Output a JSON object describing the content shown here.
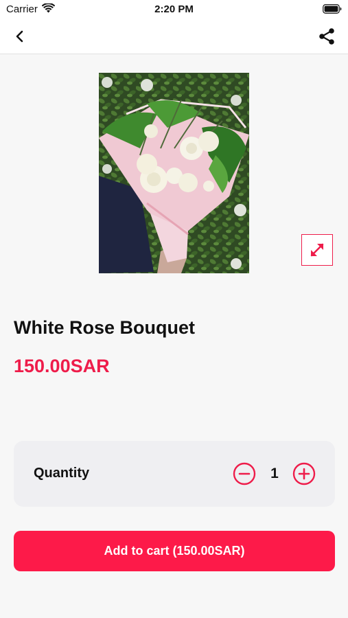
{
  "status_bar": {
    "carrier": "Carrier",
    "time": "2:20 PM",
    "icons": [
      "wifi-icon",
      "battery-icon"
    ]
  },
  "nav": {
    "back_icon": "chevron-left-icon",
    "share_icon": "share-icon"
  },
  "product": {
    "image_description_icon": "expand-icon",
    "title": "White Rose Bouquet",
    "price": "150.00SAR"
  },
  "quantity": {
    "label": "Quantity",
    "value": "1",
    "minus_icon": "minus-circle-icon",
    "plus_icon": "plus-circle-icon"
  },
  "cart": {
    "button_label": "Add to cart (150.00SAR)"
  },
  "colors": {
    "accent": "#ee1c4a",
    "button": "#fd1a49",
    "background": "#f7f7f7",
    "panel": "#efeff2"
  }
}
